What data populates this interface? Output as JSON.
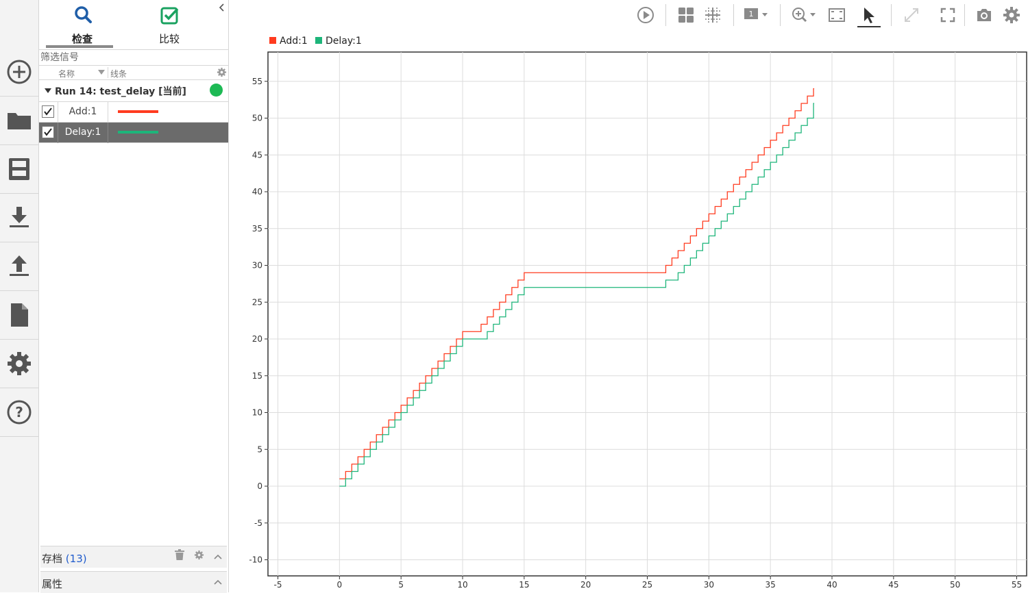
{
  "tabs": {
    "inspect_label": "检查",
    "compare_label": "比较"
  },
  "filter": {
    "placeholder": "筛选信号"
  },
  "columns": {
    "name": "名称",
    "line": "线条"
  },
  "run": {
    "label": "Run 14: test_delay [当前]",
    "status_color": "#1db954"
  },
  "signals": [
    {
      "name": "Add:1",
      "color": "#ff3b1f",
      "checked": true
    },
    {
      "name": "Delay:1",
      "color": "#1db57a",
      "checked": true
    }
  ],
  "archive": {
    "label": "存档",
    "count": "(13)"
  },
  "properties": {
    "label": "属性"
  },
  "rail_icons": [
    "add-icon",
    "folder-icon",
    "save-icon",
    "download-icon",
    "upload-icon",
    "document-icon",
    "settings-icon",
    "help-icon"
  ],
  "toolbar_icons": [
    "play-icon",
    "layout-grid-icon",
    "grid-lines-icon",
    "subplot-number-icon",
    "zoom-in-icon",
    "fit-to-view-icon",
    "cursor-icon",
    "expand-icon",
    "fullscreen-icon",
    "camera-icon",
    "settings-icon"
  ],
  "chart_data": {
    "type": "line",
    "step": true,
    "title": "",
    "xlabel": "",
    "ylabel": "",
    "xlim": [
      -5,
      55
    ],
    "ylim": [
      -10,
      58
    ],
    "xticks": [
      -5,
      0,
      5,
      10,
      15,
      20,
      25,
      30,
      35,
      40,
      45,
      50,
      55
    ],
    "yticks": [
      -10,
      -5,
      0,
      5,
      10,
      15,
      20,
      25,
      30,
      35,
      40,
      45,
      50,
      55
    ],
    "grid": true,
    "legend": "top-left",
    "series": [
      {
        "name": "Add:1",
        "color": "#ff3b1f",
        "x": [
          0,
          0.5,
          1,
          1.5,
          2,
          2.5,
          3,
          3.5,
          4,
          4.5,
          5,
          5.5,
          6,
          6.5,
          7,
          7.5,
          8,
          8.5,
          9,
          9.5,
          10,
          11.5,
          12,
          12.5,
          13,
          13.5,
          14,
          14.5,
          15,
          26.5,
          27,
          27.5,
          28,
          28.5,
          29,
          29.5,
          30,
          30.5,
          31,
          31.5,
          32,
          32.5,
          33,
          33.5,
          34,
          34.5,
          35,
          35.5,
          36,
          36.5,
          37,
          37.5,
          38,
          38.5
        ],
        "y": [
          1,
          2,
          3,
          4,
          5,
          6,
          7,
          8,
          9,
          10,
          11,
          12,
          13,
          14,
          15,
          16,
          17,
          18,
          19,
          20,
          21,
          22,
          23,
          24,
          25,
          26,
          27,
          28,
          29,
          30,
          31,
          32,
          33,
          34,
          35,
          36,
          37,
          38,
          39,
          40,
          41,
          42,
          43,
          44,
          45,
          46,
          47,
          48,
          49,
          50,
          51,
          52,
          53,
          54
        ]
      },
      {
        "name": "Delay:1",
        "color": "#1db57a",
        "x": [
          0,
          0.5,
          1,
          1.5,
          2,
          2.5,
          3,
          3.5,
          4,
          4.5,
          5,
          5.5,
          6,
          6.5,
          7,
          7.5,
          8,
          8.5,
          9,
          9.5,
          10,
          11.5,
          12,
          12.5,
          13,
          13.5,
          14,
          14.5,
          15,
          26.5,
          27,
          27.5,
          28,
          28.5,
          29,
          29.5,
          30,
          30.5,
          31,
          31.5,
          32,
          32.5,
          33,
          33.5,
          34,
          34.5,
          35,
          35.5,
          36,
          36.5,
          37,
          37.5,
          38,
          38.5
        ],
        "y": [
          0,
          1,
          2,
          3,
          4,
          5,
          6,
          7,
          8,
          9,
          10,
          11,
          12,
          13,
          14,
          15,
          16,
          17,
          18,
          19,
          20,
          20,
          21,
          22,
          23,
          24,
          25,
          26,
          27,
          28,
          28,
          29,
          30,
          31,
          32,
          33,
          34,
          35,
          36,
          37,
          38,
          39,
          40,
          41,
          42,
          43,
          44,
          45,
          46,
          47,
          48,
          49,
          50,
          52
        ]
      }
    ]
  }
}
